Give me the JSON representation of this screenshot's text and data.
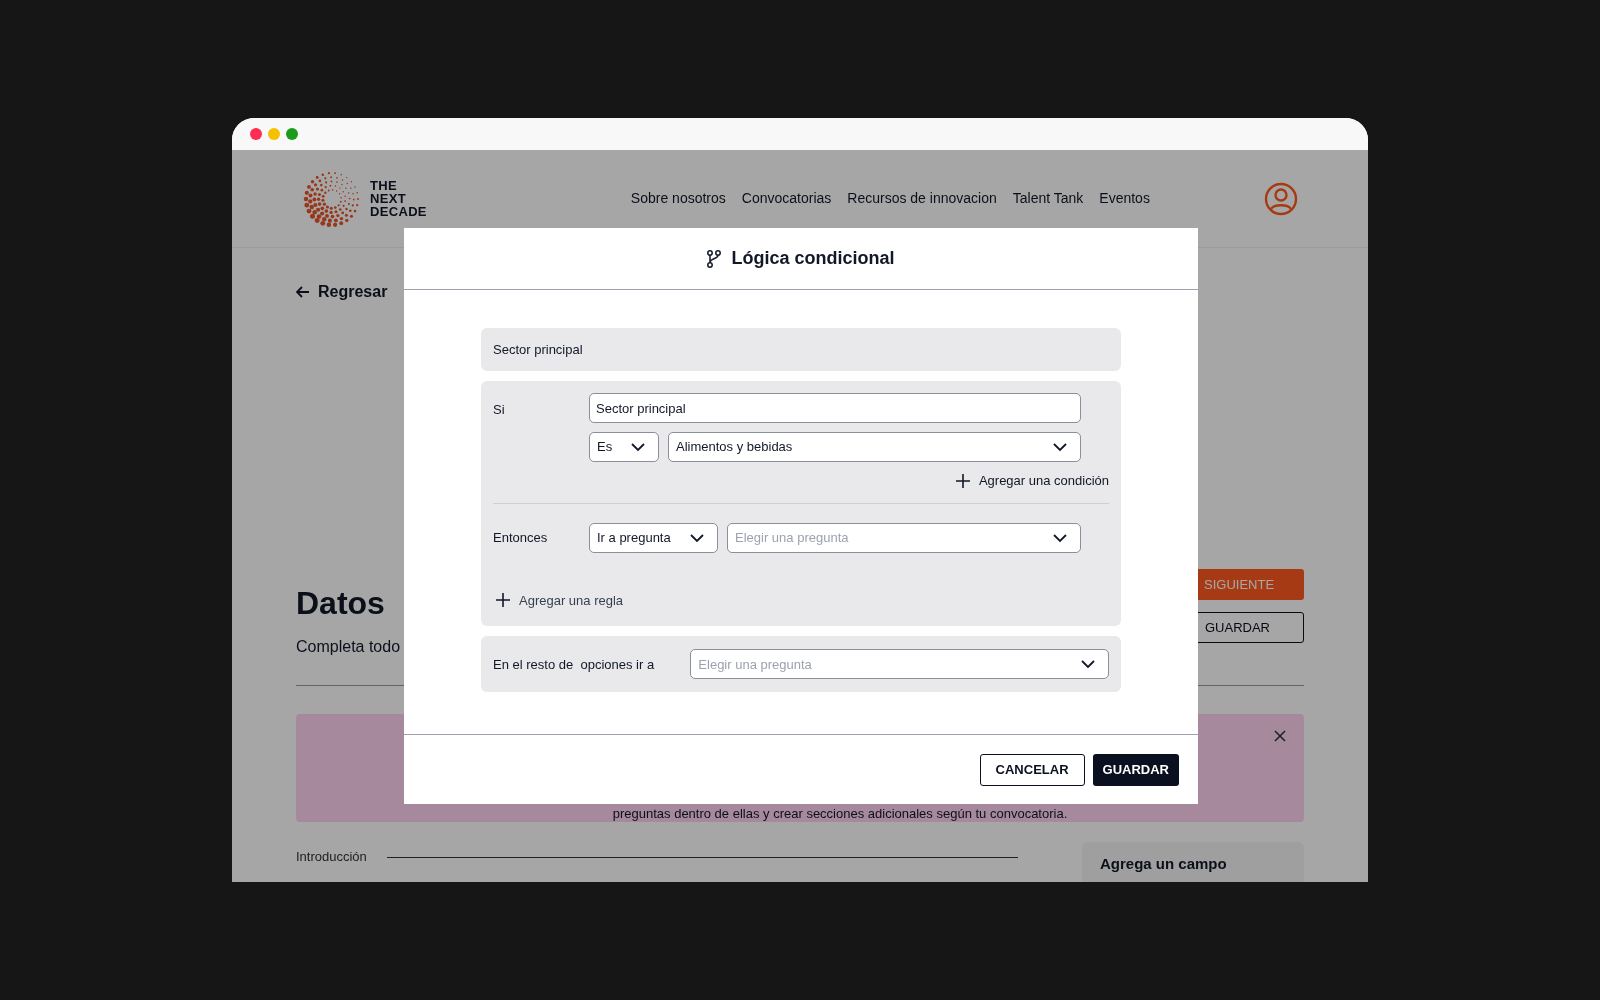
{
  "page": {
    "logo_lines": [
      "THE",
      "NEXT",
      "DECADE"
    ],
    "nav": [
      "Sobre nosotros",
      "Convocatorias",
      "Recursos de innovacion",
      "Talent Tank",
      "Eventos"
    ],
    "back": "Regresar",
    "title": "Datos",
    "subtitle": "Completa todo",
    "buttons": [
      {
        "label": "SIGUIENTE",
        "kind": "primary"
      },
      {
        "label": "GUARDAR",
        "kind": "outline"
      }
    ],
    "banner": {
      "text": "preguntas dentro de ellas y crear secciones adicionales según tu convocatoria."
    },
    "section": "Introducción",
    "side_card": "Agrega un campo"
  },
  "modal": {
    "title": "Lógica condicional",
    "question": "Sector principal",
    "rule": {
      "if_label": "Si",
      "field": "Sector principal",
      "operator": "Es",
      "value": "Alimentos y bebidas",
      "add_condition": "Agregar una condición",
      "then_label": "Entonces",
      "action": "Ir a pregunta",
      "target_placeholder": "Elegir una pregunta"
    },
    "add_rule": "Agregar una regla",
    "rest_label": "En el resto de  opciones ir a",
    "rest_placeholder": "Elegir una pregunta",
    "cancel": "CANCELAR",
    "save": "GUARDAR"
  }
}
